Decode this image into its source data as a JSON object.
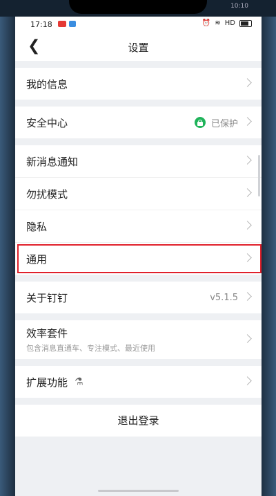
{
  "top_strip": {
    "left": "",
    "right": "10:10"
  },
  "status": {
    "time": "17:18",
    "network": "HD"
  },
  "nav": {
    "title": "设置"
  },
  "groups": {
    "g1": {
      "my_info": "我的信息"
    },
    "g2": {
      "security": "安全中心",
      "security_value": "已保护"
    },
    "g3": {
      "new_msg": "新消息通知",
      "dnd": "勿扰模式",
      "privacy": "隐私",
      "general": "通用"
    },
    "g4": {
      "about": "关于钉钉",
      "version": "v5.1.5"
    },
    "g5": {
      "efficiency": "效率套件",
      "efficiency_sub": "包含消息直通车、专注模式、最近使用"
    },
    "g6": {
      "extensions": "扩展功能"
    }
  },
  "logout": "退出登录",
  "colors": {
    "accent_green": "#1fb35a",
    "highlight_red": "#e0202a"
  }
}
